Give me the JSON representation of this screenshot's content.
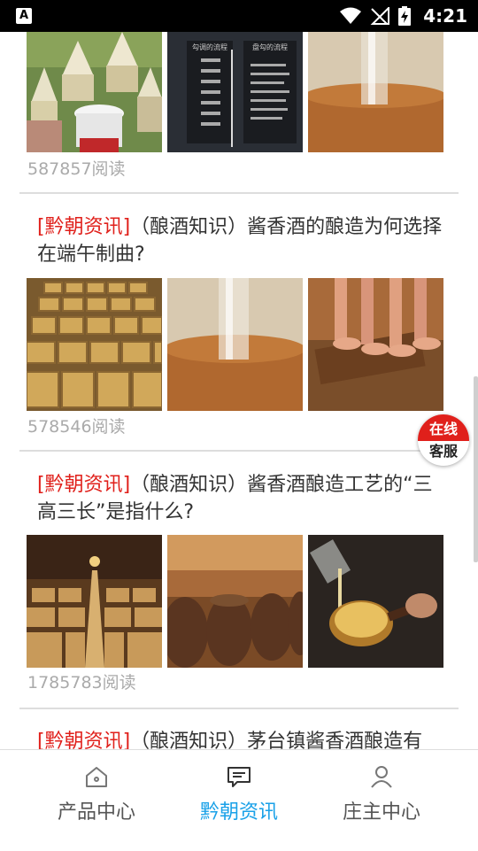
{
  "status_bar": {
    "app_badge": "A",
    "time": "4:21"
  },
  "feed": {
    "articles": [
      {
        "tag": "",
        "title": "",
        "reads": "587857阅读",
        "images": [
          "brewing-jugs-photo",
          "process-chart-photo",
          "liquor-pour-photo"
        ]
      },
      {
        "tag": "[黔朝资讯]",
        "title": "（酿酒知识）酱香酒的酿造为何选择在端午制曲?",
        "reads": "578546阅读",
        "images": [
          "qu-blocks-photo",
          "liquor-pour-photo",
          "feet-pressing-qu-photo"
        ]
      },
      {
        "tag": "[黔朝资讯]",
        "title": "（酿酒知识）酱香酒酿造工艺的“三高三长”是指什么?",
        "reads": "1785783阅读",
        "images": [
          "cellar-rows-photo",
          "storage-jars-photo",
          "liquor-ladle-photo"
        ]
      },
      {
        "tag": "[黔朝资讯]",
        "title": "（酿酒知识）茅台镇酱香酒酿造有",
        "reads": "",
        "images": []
      }
    ]
  },
  "service_button": {
    "line1": "在线",
    "line2": "客服"
  },
  "tabbar": {
    "tabs": [
      {
        "label": "产品中心",
        "icon": "home-icon",
        "active": false
      },
      {
        "label": "黔朝资讯",
        "icon": "news-icon",
        "active": true
      },
      {
        "label": "庄主中心",
        "icon": "user-icon",
        "active": false
      }
    ]
  },
  "colors": {
    "tag_red": "#e0201b",
    "active_blue": "#1aa1e8",
    "reads_gray": "#aaaaaa"
  }
}
